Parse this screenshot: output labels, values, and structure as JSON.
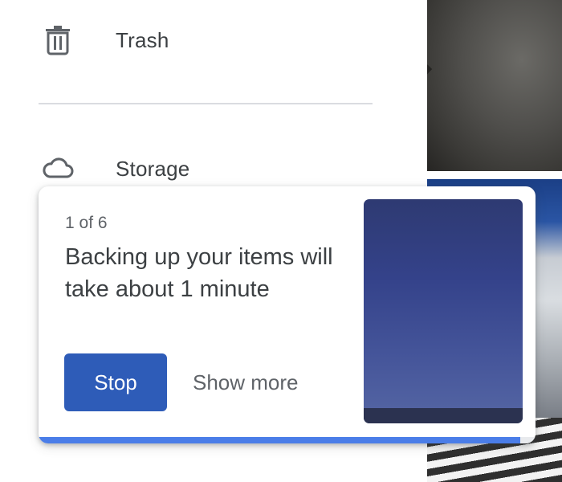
{
  "nav": {
    "items": [
      {
        "label": "Trash",
        "icon": "trash-icon"
      },
      {
        "label": "Storage",
        "icon": "cloud-icon"
      }
    ]
  },
  "backup_card": {
    "counter": "1 of 6",
    "message": "Backing up your items will take about 1 minute",
    "stop_label": "Stop",
    "show_more_label": "Show more",
    "progress_fraction": 0.97
  },
  "colors": {
    "primary_button": "#2e5cb8",
    "progress": "#4a7de8",
    "text": "#3c4043",
    "secondary_text": "#5f6368"
  }
}
